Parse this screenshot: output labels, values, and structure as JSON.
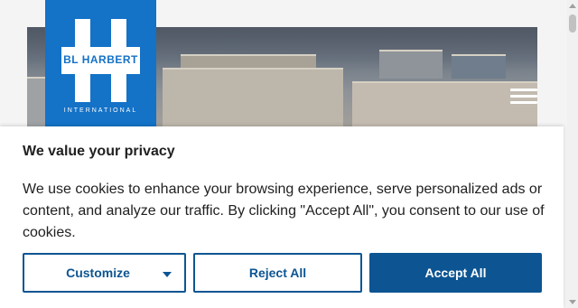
{
  "logo": {
    "brand": "BL HARBERT",
    "subtitle": "INTERNATIONAL",
    "color": "#1472c7"
  },
  "header": {
    "menu_icon": "hamburger-menu-icon"
  },
  "consent": {
    "title": "We value your privacy",
    "message": "We use cookies to enhance your browsing experience, serve personalized ads or content, and analyze our traffic. By clicking \"Accept All\", you consent to our use of cookies.",
    "buttons": {
      "customize": "Customize",
      "reject": "Reject All",
      "accept": "Accept All"
    },
    "accent_color": "#0d5592"
  }
}
